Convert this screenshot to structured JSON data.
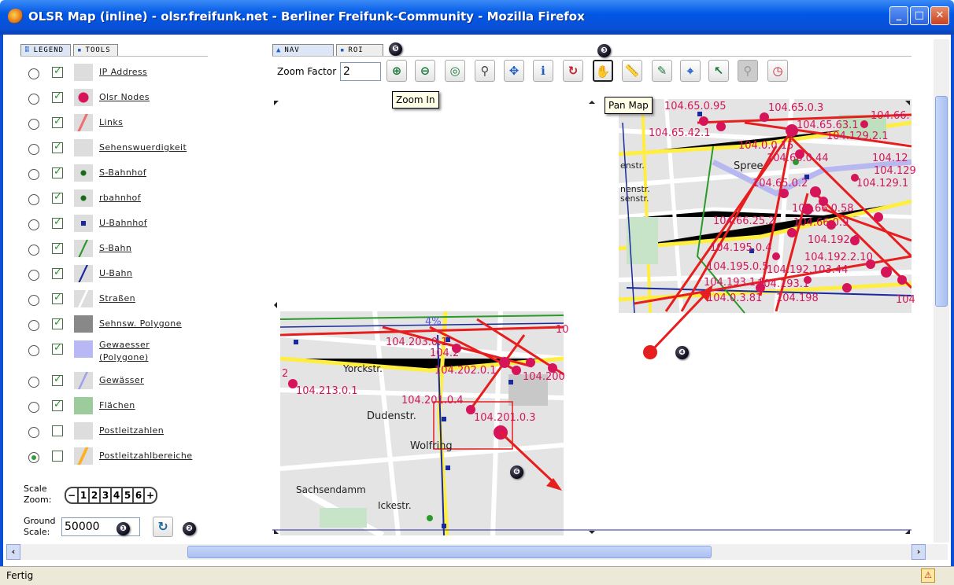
{
  "window": {
    "title": "OLSR Map (inline) - olsr.freifunk.net - Berliner Freifunk-Community - Mozilla Firefox",
    "min": "_",
    "max": "□",
    "close": "✕"
  },
  "left_tabs": [
    {
      "icon": "⠿",
      "label": "LEGEND"
    },
    {
      "icon": "▪",
      "label": "TOOLS"
    }
  ],
  "legend": [
    {
      "label": "IP Address",
      "checked": true,
      "radio": false,
      "swatch": "blank"
    },
    {
      "label": "Olsr Nodes",
      "checked": true,
      "radio": false,
      "swatch": "dot-magenta"
    },
    {
      "label": "Links",
      "checked": true,
      "radio": false,
      "swatch": "line-red"
    },
    {
      "label": "Sehenswuerdigkeit",
      "checked": true,
      "radio": false,
      "swatch": "blank"
    },
    {
      "label": "S-Bahnhof",
      "checked": true,
      "radio": false,
      "swatch": "dot-green"
    },
    {
      "label": "rbahnhof",
      "checked": true,
      "radio": false,
      "swatch": "dot-green"
    },
    {
      "label": "U-Bahnhof",
      "checked": true,
      "radio": false,
      "swatch": "square-blue"
    },
    {
      "label": "S-Bahn",
      "checked": true,
      "radio": false,
      "swatch": "line-green"
    },
    {
      "label": "U-Bahn",
      "checked": true,
      "radio": false,
      "swatch": "line-blue"
    },
    {
      "label": "Straßen",
      "checked": true,
      "radio": false,
      "swatch": "line-white"
    },
    {
      "label": "Sehnsw. Polygone",
      "checked": true,
      "radio": false,
      "swatch": "fill-gray"
    },
    {
      "label": "Gewaesser (Polygone)",
      "checked": true,
      "radio": false,
      "swatch": "fill-lavender"
    },
    {
      "label": "Gewässer",
      "checked": true,
      "radio": false,
      "swatch": "line-lavender"
    },
    {
      "label": "Flächen",
      "checked": true,
      "radio": false,
      "swatch": "fill-green"
    },
    {
      "label": "Postleitzahlen",
      "checked": false,
      "radio": false,
      "swatch": "blank"
    },
    {
      "label": "Postleitzahlbereiche",
      "checked": false,
      "radio": true,
      "swatch": "line-orange"
    }
  ],
  "scale_zoom": {
    "label1": "Scale",
    "label2": "Zoom:",
    "minus": "−",
    "plus": "+",
    "levels": [
      "1",
      "2",
      "3",
      "4",
      "5",
      "6"
    ]
  },
  "ground_scale": {
    "label1": "Ground",
    "label2": "Scale:",
    "value": "50000"
  },
  "nav_tabs": [
    {
      "icon": "▲",
      "label": "NAV"
    },
    {
      "icon": "▪",
      "label": "ROI"
    }
  ],
  "zoom_factor": {
    "label": "Zoom Factor",
    "value": "2"
  },
  "tools": [
    {
      "name": "zoom-in-icon",
      "glyph": "⊕",
      "color": "#1b7a3a"
    },
    {
      "name": "zoom-out-icon",
      "glyph": "⊖",
      "color": "#1b7a3a"
    },
    {
      "name": "zoom-extent-icon",
      "glyph": "◎",
      "color": "#1b7a3a"
    },
    {
      "name": "zoom-xy-icon",
      "glyph": "⚲",
      "color": "#444"
    },
    {
      "name": "pan-cross-icon",
      "glyph": "✥",
      "color": "#1b5ec7"
    },
    {
      "name": "info-icon",
      "glyph": "ℹ",
      "color": "#1b5ec7"
    },
    {
      "name": "recenter-icon",
      "glyph": "↻",
      "color": "#c02030"
    },
    {
      "name": "pan-hand-icon",
      "glyph": "✋",
      "color": "#333"
    },
    {
      "name": "measure-icon",
      "glyph": "📏",
      "color": "#b08010"
    },
    {
      "name": "select-poly-icon",
      "glyph": "✎",
      "color": "#1b7a3a"
    },
    {
      "name": "select-icon",
      "glyph": "⌖",
      "color": "#1b5ec7"
    },
    {
      "name": "select-point-icon",
      "glyph": "↖",
      "color": "#1b7a3a"
    },
    {
      "name": "disabled-tool-icon",
      "glyph": "⚲",
      "color": "#999"
    },
    {
      "name": "clock-icon",
      "glyph": "◷",
      "color": "#c02030"
    }
  ],
  "tooltips": {
    "zoom_in": "Zoom In",
    "pan_map": "Pan Map"
  },
  "callouts": [
    "❶",
    "❷",
    "❸",
    "❹",
    "❺",
    "❻"
  ],
  "map_labels_right": [
    "104.65.0.95",
    "104.65.0.3",
    "104.66.",
    "104.65.42.1",
    "104.65.63.1",
    "104.129.2.1",
    "104.0.0.15",
    "104.12",
    "104.66.0.44",
    "Spree",
    "104.129",
    "104.129.1",
    "104.65.0.2",
    "104.66.0.58",
    "104.66.25.2",
    "104.66.0.9",
    "104.192.2",
    "104.195.0.4",
    "104.192.2.10",
    "104.195.0.5",
    "104.192.103.44",
    "104.193.1.1",
    "104.193.1",
    "104.0.3.81",
    "104.198",
    "104",
    "enstr.",
    "nenstr.",
    "senstr."
  ],
  "map_labels_left": [
    "4%",
    "104.203.0.1",
    "104.2",
    "104.202.0.1",
    "104.200",
    "104.213.0.1",
    "104.201.0.4",
    "104.201.0.3",
    "Dudenstr.",
    "Wolfring",
    "Yorckstr.",
    "Sachsendamm",
    "Ickestr.",
    "2",
    "10"
  ],
  "status": {
    "text": "Fertig"
  },
  "colors": {
    "node": "#d6145a",
    "link": "#e61e1e",
    "road": "#ffee40",
    "ubahn": "#1a2a9c",
    "sbahn": "#2a9a2a"
  }
}
